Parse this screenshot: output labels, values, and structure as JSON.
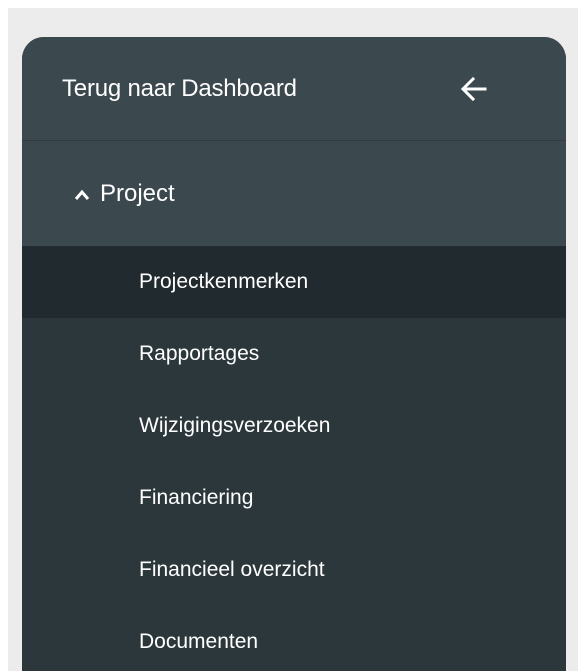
{
  "colors": {
    "page_background": "#ececec",
    "sidebar_background": "#2c373c",
    "header_background": "#3b484e",
    "active_item_background": "#212a2e",
    "text": "#ffffff"
  },
  "sidebar": {
    "back": {
      "label": "Terug naar Dashboard",
      "icon": "arrow-left-icon"
    },
    "section": {
      "label": "Project",
      "icon": "chevron-up-icon",
      "expanded": true
    },
    "items": [
      {
        "label": "Projectkenmerken",
        "active": true
      },
      {
        "label": "Rapportages",
        "active": false
      },
      {
        "label": "Wijzigingsverzoeken",
        "active": false
      },
      {
        "label": "Financiering",
        "active": false
      },
      {
        "label": "Financieel overzicht",
        "active": false
      },
      {
        "label": "Documenten",
        "active": false
      }
    ]
  }
}
